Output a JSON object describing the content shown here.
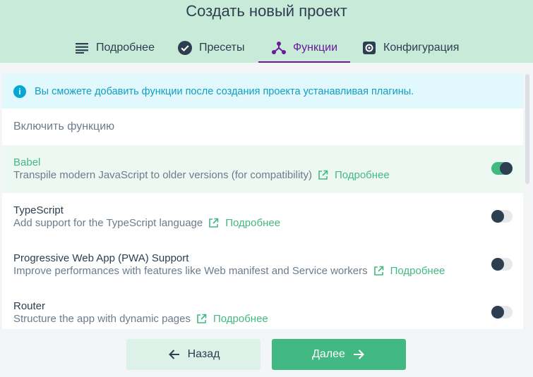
{
  "header": {
    "title": "Создать новый проект",
    "tabs": [
      {
        "label": "Подробнее",
        "icon": "list-icon",
        "active": false
      },
      {
        "label": "Пресеты",
        "icon": "check-circle-icon",
        "active": false
      },
      {
        "label": "Функции",
        "icon": "device-hub-icon",
        "active": true
      },
      {
        "label": "Конфигурация",
        "icon": "settings-icon",
        "active": false
      }
    ]
  },
  "info": {
    "icon": "info-icon",
    "text": "Вы сможете добавить функции после создания проекта устанавливая плагины."
  },
  "section_title": "Включить функцию",
  "features": [
    {
      "name": "Babel",
      "description": "Transpile modern JavaScript to older versions (for compatibility)",
      "more_label": "Подробнее",
      "enabled": true
    },
    {
      "name": "TypeScript",
      "description": "Add support for the TypeScript language",
      "more_label": "Подробнее",
      "enabled": false
    },
    {
      "name": "Progressive Web App (PWA) Support",
      "description": "Improve performances with features like Web manifest and Service workers",
      "more_label": "Подробнее",
      "enabled": false
    },
    {
      "name": "Router",
      "description": "Structure the app with dynamic pages",
      "more_label": "Подробнее",
      "enabled": false
    }
  ],
  "buttons": {
    "back_label": "Назад",
    "next_label": "Далее"
  },
  "colors": {
    "header_bg": "#c8ead9",
    "accent": "#42b983",
    "active_tab": "#6a1b9a",
    "info_bg": "#e1f8fc",
    "info_icon": "#03a9d4"
  }
}
